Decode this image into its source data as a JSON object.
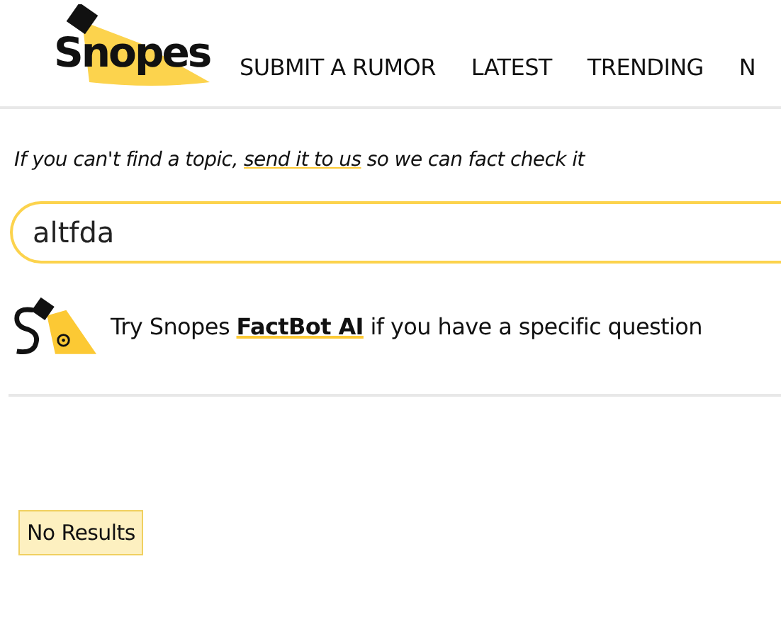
{
  "header": {
    "logo": "Snopes",
    "nav": [
      {
        "label": "SUBMIT A RUMOR"
      },
      {
        "label": "LATEST"
      },
      {
        "label": "TRENDING"
      },
      {
        "label": "N"
      }
    ]
  },
  "intro": {
    "before": "If you can't find a topic, ",
    "link": "send it to us",
    "after": " so we can fact check it"
  },
  "search": {
    "value": "altfda"
  },
  "factbot": {
    "before": "Try Snopes ",
    "link": "FactBot AI",
    "after": " if you have a specific question"
  },
  "results": {
    "message": "No Results"
  }
}
